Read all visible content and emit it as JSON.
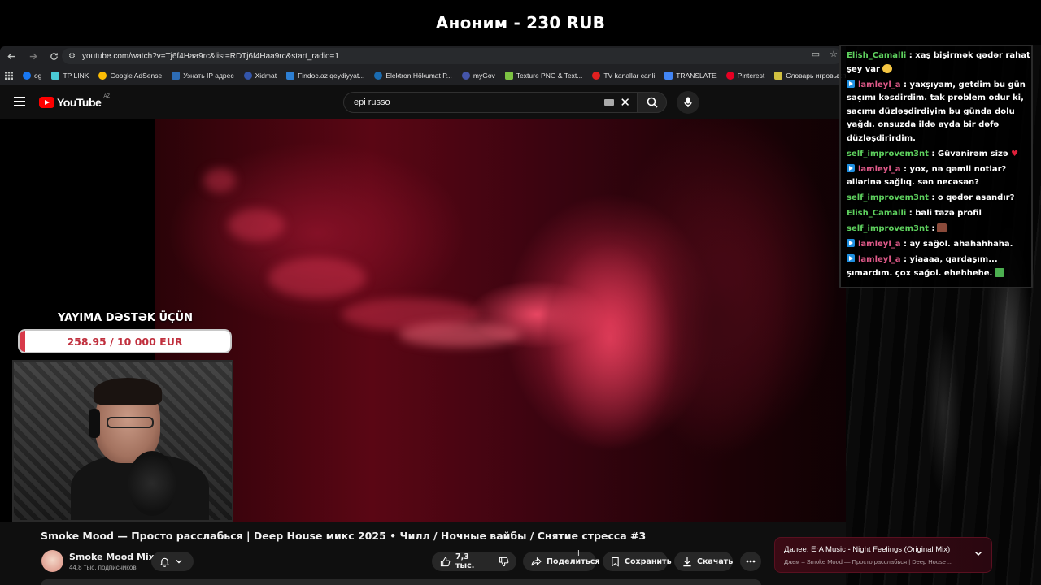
{
  "donation_banner": "Аноним - 230 RUB",
  "browser": {
    "url": "youtube.com/watch?v=Tj6f4Haa9rc&list=RDTj6f4Haa9rc&start_radio=1",
    "bookmarks": [
      {
        "label": "og",
        "color": "#1877f2"
      },
      {
        "label": "TP LINK",
        "color": "#4acbd6"
      },
      {
        "label": "Google AdSense",
        "color": "#fbbc04"
      },
      {
        "label": "Узнать IP адрес",
        "color": "#2d6cb5"
      },
      {
        "label": "Xidmat",
        "color": "#3355aa"
      },
      {
        "label": "Findoc.az qeydiyyat...",
        "color": "#2d7fd3"
      },
      {
        "label": "Elektron Hökumat P...",
        "color": "#1a6bb0"
      },
      {
        "label": "myGov",
        "color": "#4455aa"
      },
      {
        "label": "Texture PNG & Text...",
        "color": "#7cc242"
      },
      {
        "label": "TV kanallar canli",
        "color": "#e02020"
      },
      {
        "label": "TRANSLATE",
        "color": "#4285f4"
      },
      {
        "label": "Pinterest",
        "color": "#e60023"
      },
      {
        "label": "Словарь игровых т...",
        "color": "#d0c040"
      }
    ]
  },
  "youtube": {
    "logo_text": "YouTube",
    "country_code": "AZ",
    "search_query": "epi russo",
    "video_title": "Smoke Mood — Просто расслабься | Deep House микс 2025 • Чилл / Ночные вайбы / Снятие стресса #3",
    "channel_name": "Smoke Mood Mix",
    "subscribers": "44,8 тыс. подписчиков",
    "actions": {
      "likes": "7,3 тыс.",
      "share": "Поделиться",
      "save": "Сохранить",
      "download": "Скачать"
    },
    "next_up": {
      "label": "Далее:",
      "title": "ErA Music - Night Feelings (Original Mix)",
      "subtitle": "Джем – Smoke Mood — Просто расслабься | Deep House ..."
    }
  },
  "goal": {
    "title": "YAYIMA DƏSTƏK ÜÇÜN",
    "text": "258.95 / 10 000 EUR",
    "progress_fraction": 0.026
  },
  "chat": {
    "messages": [
      {
        "user": "Elish_Camalli",
        "color": "#5ed15e",
        "badge": false,
        "text": ": xaş bişirmək qədər rahat şey var"
      },
      {
        "user": "lamleyl_a",
        "color": "#e05a8a",
        "badge": true,
        "text": ": yaxşıyam, getdim bu gün saçımı kəsdirdim. tak problem odur ki, saçımı düzləşdirdiyim bu günda dolu yağdı. onsuzda ildə ayda bir dəfə düzləşdirirdim."
      },
      {
        "user": "self_improvem3nt",
        "color": "#5ed15e",
        "badge": false,
        "text": ": Güvənirəm sizə"
      },
      {
        "user": "lamleyl_a",
        "color": "#e05a8a",
        "badge": true,
        "text": ": yox, nə qəmli notlar? əllərinə sağlıq. sən necəsən?"
      },
      {
        "user": "self_improvem3nt",
        "color": "#5ed15e",
        "badge": false,
        "text": ": o qədər asandır?"
      },
      {
        "user": "Elish_Camalli",
        "color": "#5ed15e",
        "badge": false,
        "text": ": bəli təzə profil"
      },
      {
        "user": "self_improvem3nt",
        "color": "#5ed15e",
        "badge": false,
        "text": ":"
      },
      {
        "user": "lamleyl_a",
        "color": "#e05a8a",
        "badge": true,
        "text": ": ay sağol. ahahahhaha."
      },
      {
        "user": "lamleyl_a",
        "color": "#e05a8a",
        "badge": true,
        "text": ": yiaaaa, qardaşım... şımardım. çox sağol. ehehhehe."
      }
    ]
  }
}
